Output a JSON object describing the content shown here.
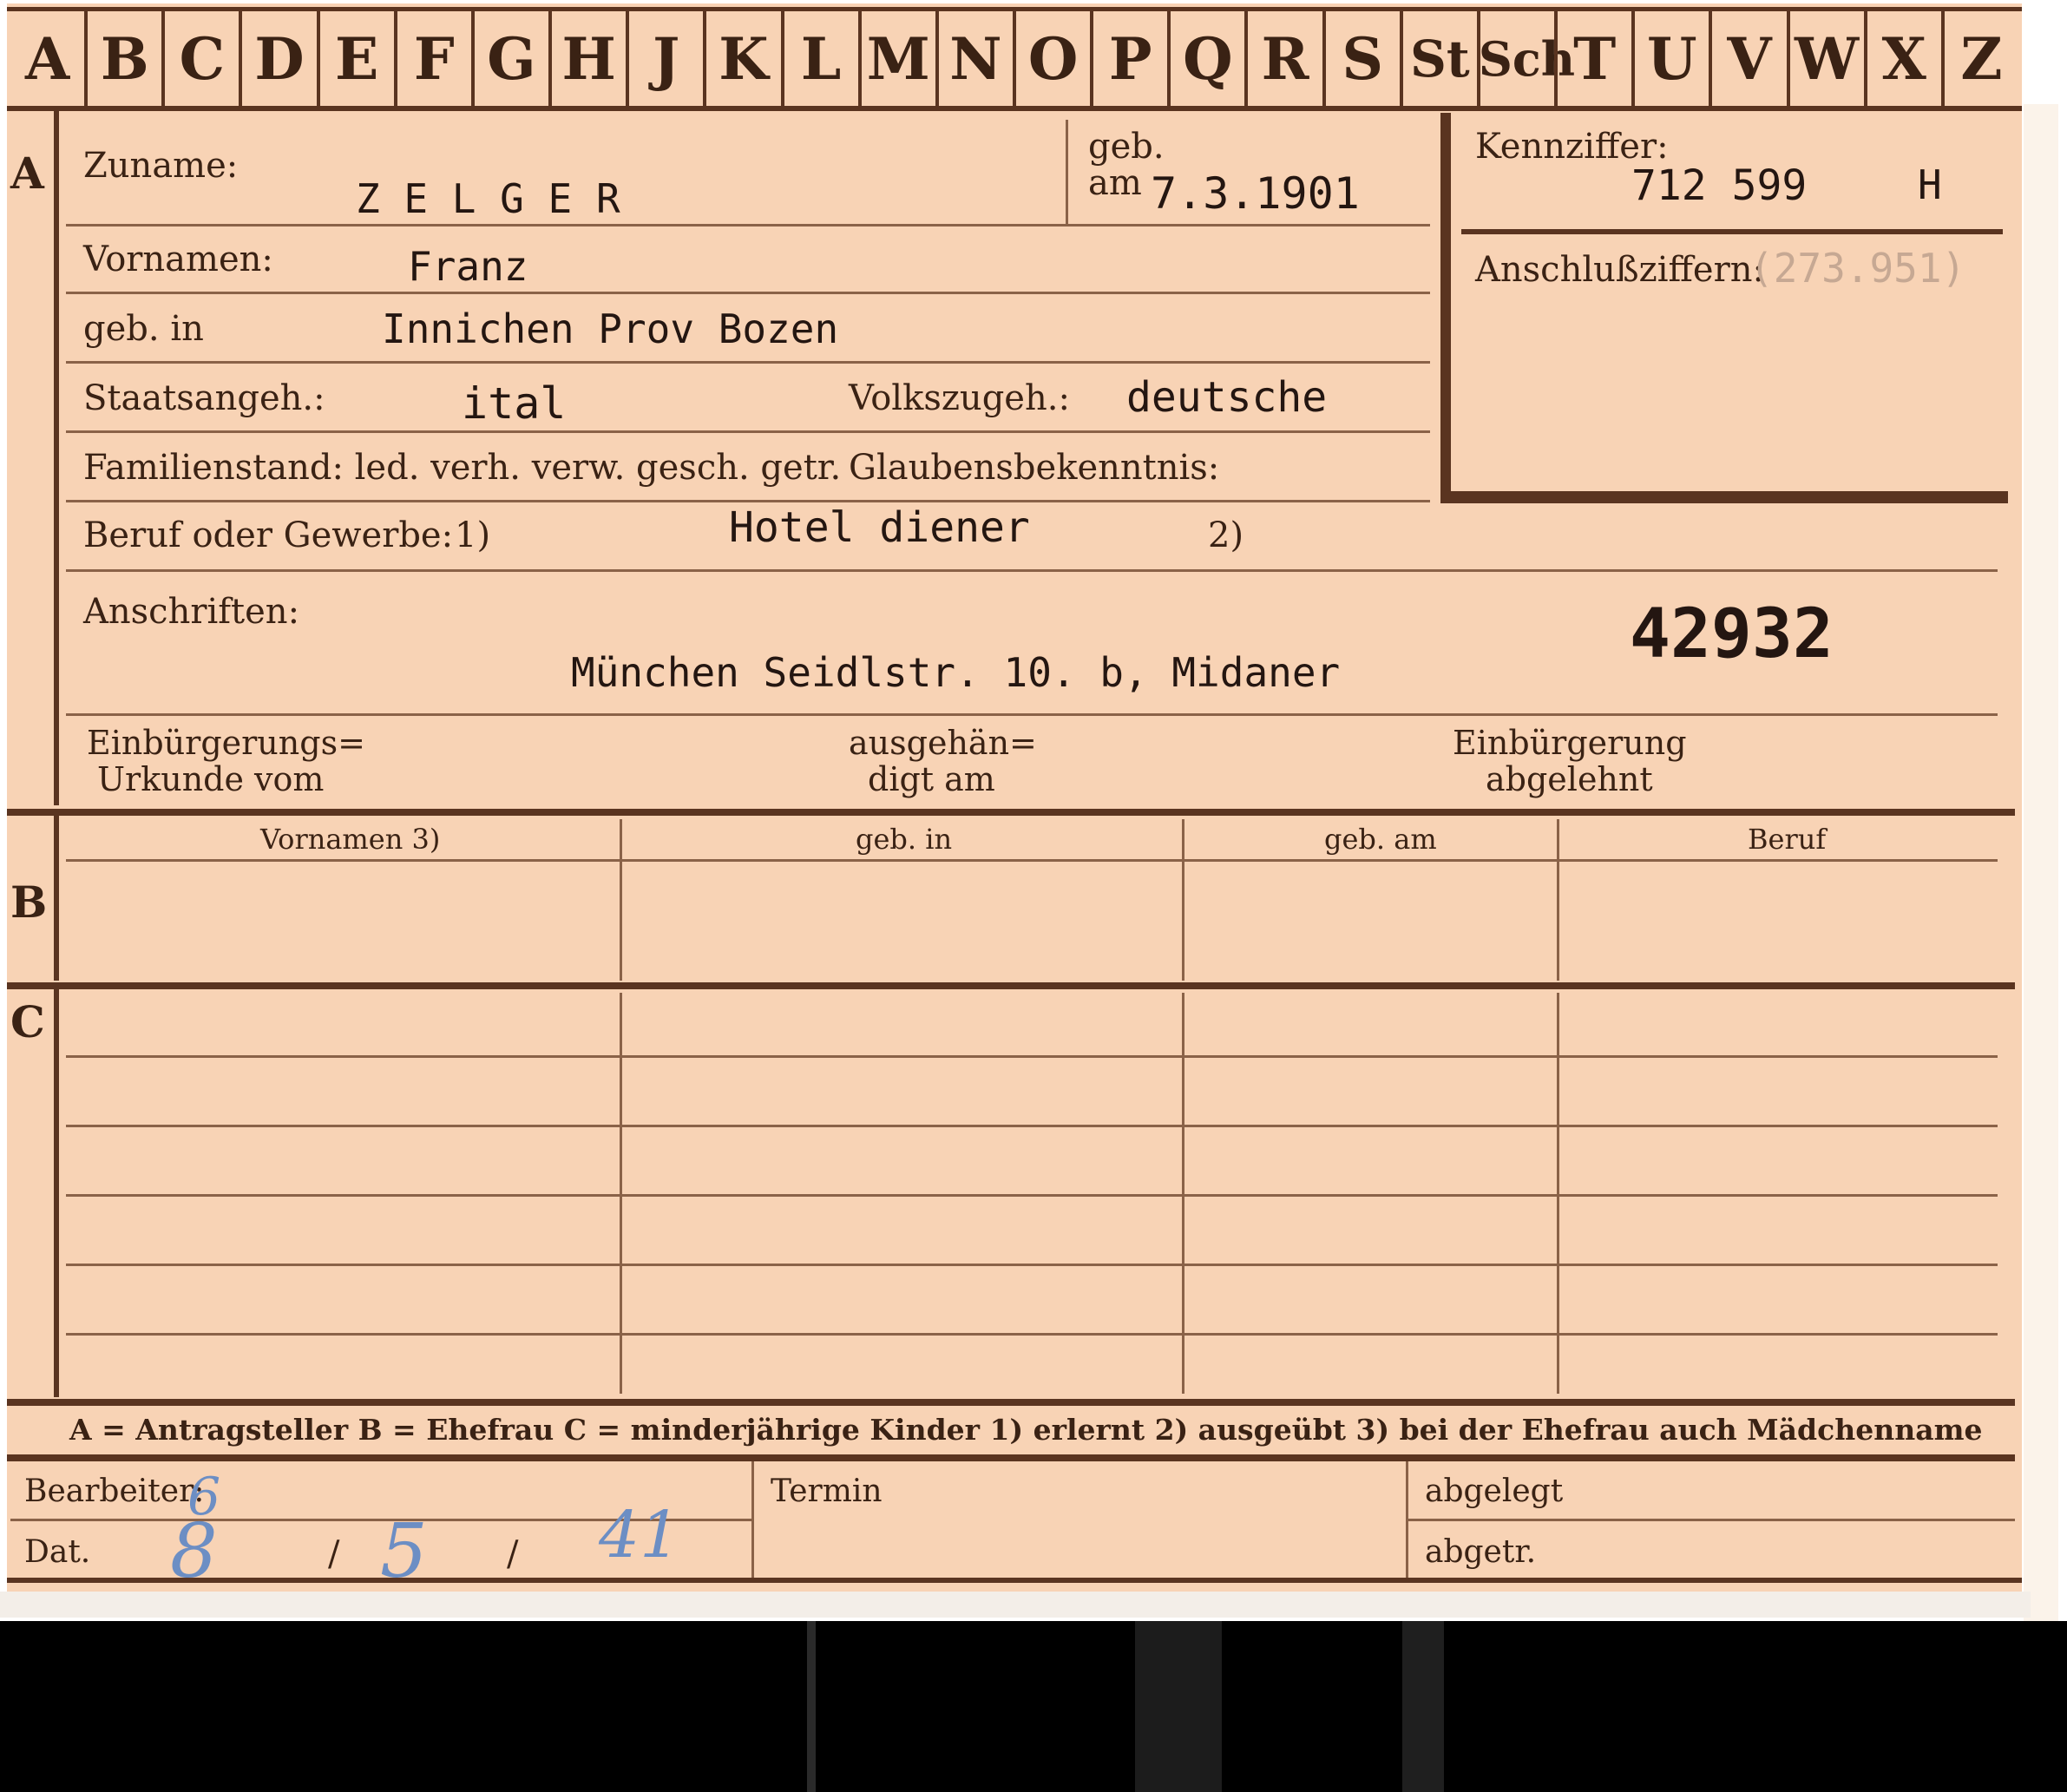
{
  "alphabet_tabs": [
    "A",
    "B",
    "C",
    "D",
    "E",
    "F",
    "G",
    "H",
    "J",
    "K",
    "L",
    "M",
    "N",
    "O",
    "P",
    "Q",
    "R",
    "S",
    "St",
    "Sch",
    "T",
    "U",
    "V",
    "W",
    "X",
    "Z"
  ],
  "sections": {
    "a": "A",
    "b": "B",
    "c": "C"
  },
  "person": {
    "surname_label": "Zuname:",
    "surname_value": "Z E L G E R",
    "born_label": "geb.",
    "born_on_label": "am",
    "born_on_value": "7.3.1901",
    "first_names_label": "Vornamen:",
    "first_names_value": "Franz",
    "birthplace_label": "geb. in",
    "birthplace_value": "Innichen Prov Bozen",
    "citizenship_label": "Staatsangeh.:",
    "citizenship_value": "ital",
    "ethnicity_label": "Volkszugeh.:",
    "ethnicity_value": "deutsche",
    "marital_label": "Familienstand: led. verh. verw. gesch. getr.",
    "religion_label": "Glaubensbekenntnis:",
    "profession_label": "Beruf oder Gewerbe:",
    "profession_note1": "1)",
    "profession_value": "Hotel diener",
    "profession_note2": "2)",
    "addresses_label": "Anschriften:",
    "address_value": "München Seidlstr. 10. b, Midaner",
    "stamp_number": "42932",
    "naturalization_doc_label_1": "Einbürgerungs=",
    "naturalization_doc_label_2": "Urkunde vom",
    "handed_out_label_1": "ausgehän=",
    "handed_out_label_2": "digt am",
    "naturalization_refused_1": "Einbürgerung",
    "naturalization_refused_2": "abgelehnt"
  },
  "id_box": {
    "code_label": "Kennziffer:",
    "code_value": "712 599",
    "code_suffix": "H",
    "linked_label": "Anschlußziffern:",
    "linked_value": "(273.951)"
  },
  "family_table": {
    "headers": [
      "Vornamen 3)",
      "geb. in",
      "geb. am",
      "Beruf"
    ]
  },
  "legend": "A = Antragsteller   B = Ehefrau   C = minderjährige Kinder   1) erlernt   2) ausgeübt   3) bei der Ehefrau auch Mädchenname",
  "footer": {
    "clerk_label": "Bearbeiter:",
    "date_label": "Dat.",
    "date_day": "8",
    "date_month": "5",
    "date_year": "41",
    "clerk_mark": "6",
    "sep1": "/",
    "sep2": "/",
    "deadline_label": "Termin",
    "filed_label": "abgelegt",
    "removed_label": "abgetr."
  }
}
